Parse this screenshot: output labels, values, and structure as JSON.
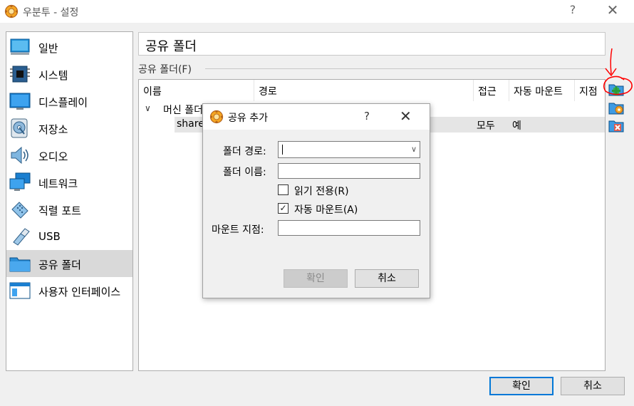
{
  "window": {
    "title": "우분투 - 설정",
    "help_glyph": "?",
    "close_glyph": "✕"
  },
  "sidebar": {
    "items": [
      {
        "label": "일반",
        "icon": "general-icon"
      },
      {
        "label": "시스템",
        "icon": "system-chip-icon"
      },
      {
        "label": "디스플레이",
        "icon": "display-monitor-icon"
      },
      {
        "label": "저장소",
        "icon": "storage-disk-icon"
      },
      {
        "label": "오디오",
        "icon": "audio-speaker-icon"
      },
      {
        "label": "네트워크",
        "icon": "network-icon"
      },
      {
        "label": "직렬 포트",
        "icon": "serial-port-icon"
      },
      {
        "label": "USB",
        "icon": "usb-icon"
      },
      {
        "label": "공유 폴더",
        "icon": "shared-folder-icon",
        "selected": true
      },
      {
        "label": "사용자 인터페이스",
        "icon": "user-interface-icon"
      }
    ]
  },
  "page": {
    "title": "공유 폴더",
    "group_label": "공유 폴더(F)"
  },
  "table": {
    "columns": [
      "이름",
      "경로",
      "접근",
      "자동 마운트",
      "지점"
    ],
    "group": {
      "label": "머신 폴더"
    },
    "rows": [
      {
        "name": "share",
        "path": "",
        "access": "모두",
        "auto_mount": "예",
        "point": ""
      }
    ]
  },
  "actions": {
    "add": "add-shared-folder-icon",
    "edit": "edit-shared-folder-icon",
    "remove": "remove-shared-folder-icon"
  },
  "buttons": {
    "ok": "확인",
    "cancel": "취소"
  },
  "dialog": {
    "title": "공유 추가",
    "help_glyph": "?",
    "close_glyph": "✕",
    "folder_path_label": "폴더 경로:",
    "folder_path_value": "",
    "folder_name_label": "폴더 이름:",
    "folder_name_value": "",
    "read_only_label": "읽기 전용(R)",
    "read_only_checked": false,
    "auto_mount_label": "자동 마운트(A)",
    "auto_mount_checked": true,
    "mount_point_label": "마운트 지점:",
    "mount_point_value": "",
    "ok": "확인",
    "cancel": "취소"
  },
  "colors": {
    "selection": "#d9d9d9",
    "focus_border": "#0078d7",
    "annotation": "#ff0000"
  }
}
